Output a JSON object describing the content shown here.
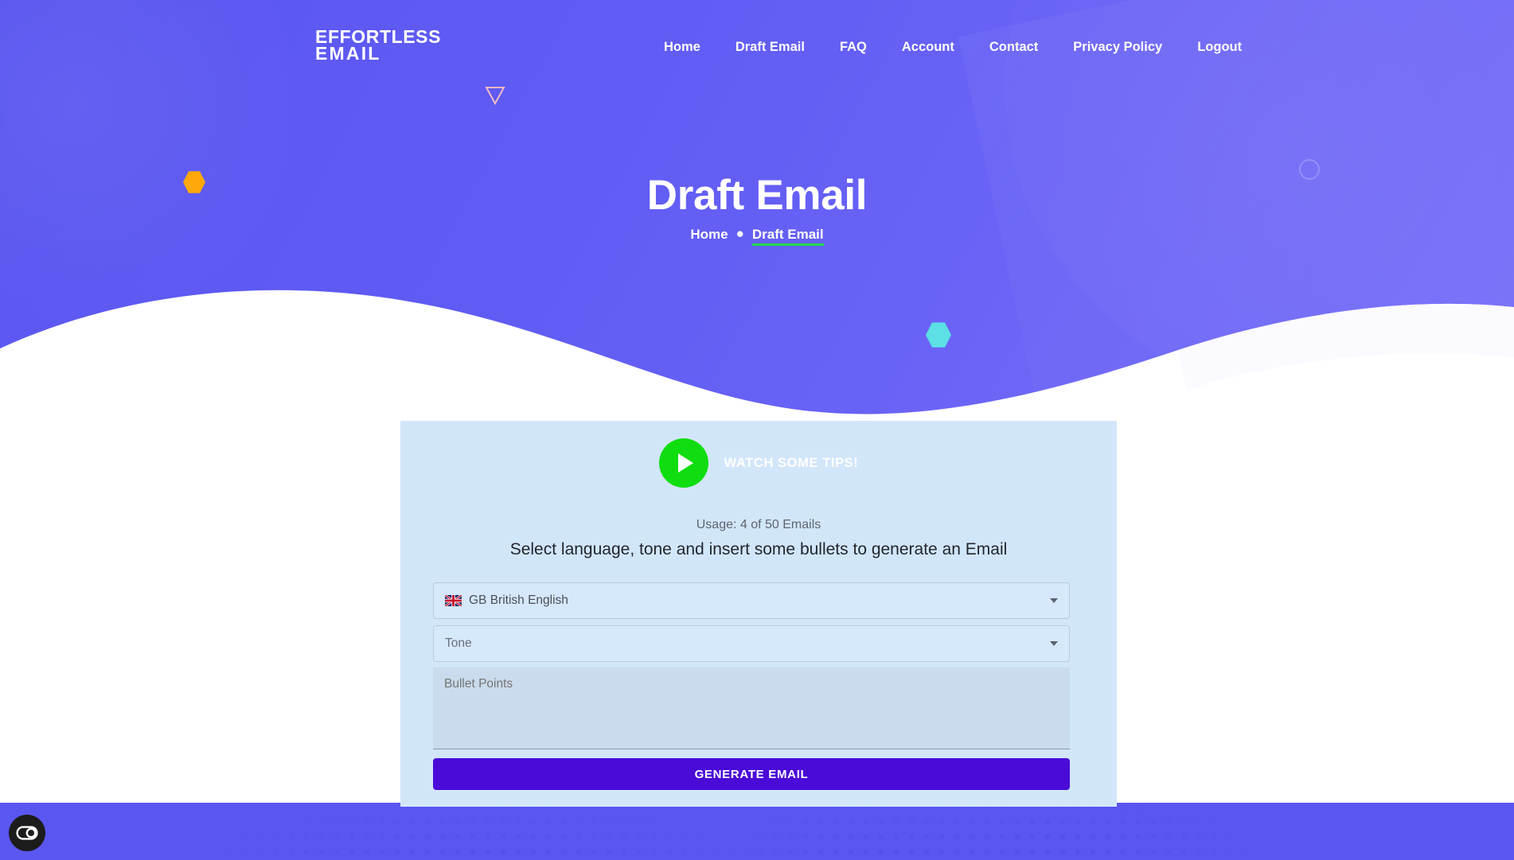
{
  "brand": {
    "line1": "EFFORTLESS",
    "line2": "EMAIL"
  },
  "nav": {
    "items": [
      {
        "label": "Home",
        "name": "nav-home"
      },
      {
        "label": "Draft Email",
        "name": "nav-draft-email"
      },
      {
        "label": "FAQ",
        "name": "nav-faq"
      },
      {
        "label": "Account",
        "name": "nav-account"
      },
      {
        "label": "Contact",
        "name": "nav-contact"
      },
      {
        "label": "Privacy Policy",
        "name": "nav-privacy-policy"
      },
      {
        "label": "Logout",
        "name": "nav-logout"
      }
    ]
  },
  "hero": {
    "title": "Draft Email",
    "breadcrumb": {
      "home": "Home",
      "separator": "●",
      "current": "Draft Email",
      "underline_color": "#22d94b"
    }
  },
  "card": {
    "tips": {
      "label": "WATCH SOME TIPS!",
      "play_icon": "play-icon",
      "button_color": "#10dd10"
    },
    "usage": "Usage: 4 of 50 Emails",
    "heading": "Select language, tone and insert some bullets to generate an Email",
    "language_field": {
      "value": "GB British English",
      "flag": "gb-flag-icon",
      "caret": "chevron-down-icon"
    },
    "tone_field": {
      "placeholder": "Tone",
      "caret": "chevron-down-icon"
    },
    "bullets_field": {
      "placeholder": "Bullet Points",
      "value": ""
    },
    "generate_button": {
      "label": "GENERATE EMAIL",
      "color": "#4a0ad8"
    }
  },
  "decor": {
    "hexagon_orange": "#ffa809",
    "hexagon_cyan": "#5ce0e6",
    "triangle_outline": "#f6b6c4",
    "hero_gradient_start": "#5a56f0",
    "hero_gradient_end": "#7a72f8",
    "card_background": "#d2e6fa",
    "footer_background": "#5a56f0"
  },
  "widget": {
    "name": "accessibility-widget",
    "icon": "toggle-circle-icon"
  }
}
